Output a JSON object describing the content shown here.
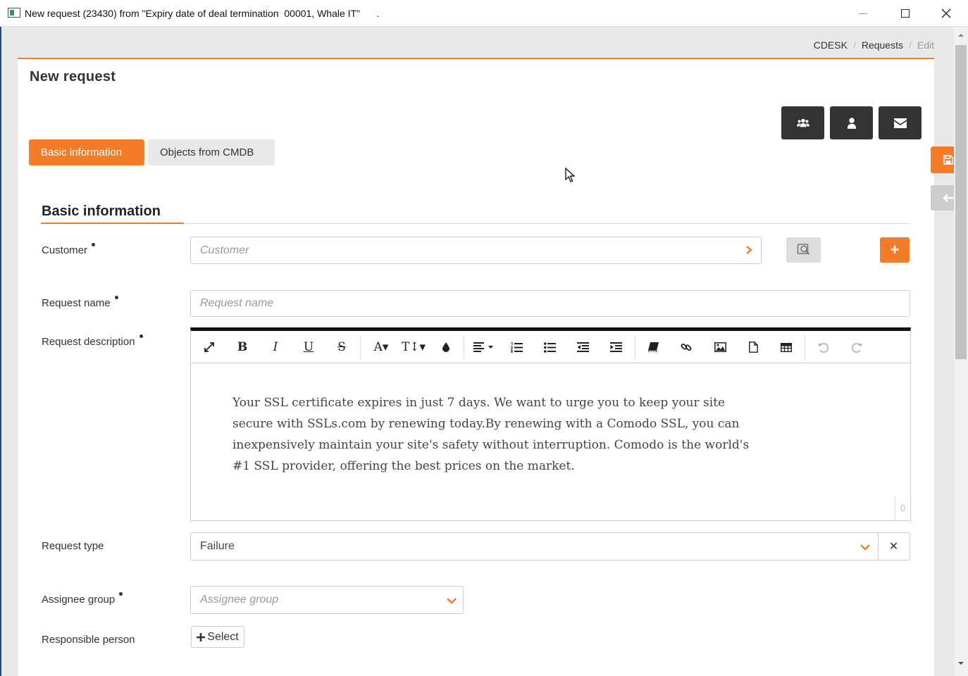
{
  "window": {
    "title": "New request (23430) from \"Expiry date of deal termination  00001, Whale IT\"      ."
  },
  "breadcrumb": {
    "items": [
      "CDESK",
      "Requests"
    ],
    "current": "Edit"
  },
  "page": {
    "title": "New request"
  },
  "header_buttons": [
    {
      "name": "group-icon"
    },
    {
      "name": "user-icon"
    },
    {
      "name": "envelope-icon"
    }
  ],
  "tabs": [
    {
      "label": "Basic information",
      "active": true
    },
    {
      "label": "Objects from CMDB",
      "active": false
    }
  ],
  "section": {
    "title": "Basic information"
  },
  "form": {
    "customer": {
      "label": "Customer",
      "placeholder": "Customer",
      "required": true
    },
    "request_name": {
      "label": "Request name",
      "placeholder": "Request name",
      "required": true
    },
    "request_description": {
      "label": "Request description",
      "required": true,
      "text": "Your SSL certificate expires in just 7 days. We want to urge you to keep your site secure with SSLs.com by renewing today.By renewing with a Comodo SSL, you can inexpensively maintain your site's safety without interruption. Comodo is the world's #1 SSL provider, offering the best prices on the market.",
      "char_count": "0"
    },
    "request_type": {
      "label": "Request type",
      "value": "Failure"
    },
    "assignee_group": {
      "label": "Assignee group",
      "placeholder": "Assignee group",
      "required": true
    },
    "responsible_person": {
      "label": "Responsible person",
      "button_label": "Select"
    }
  },
  "colors": {
    "accent": "#f47b28",
    "dark_button": "#333333",
    "toolbar_top": "#111111"
  }
}
